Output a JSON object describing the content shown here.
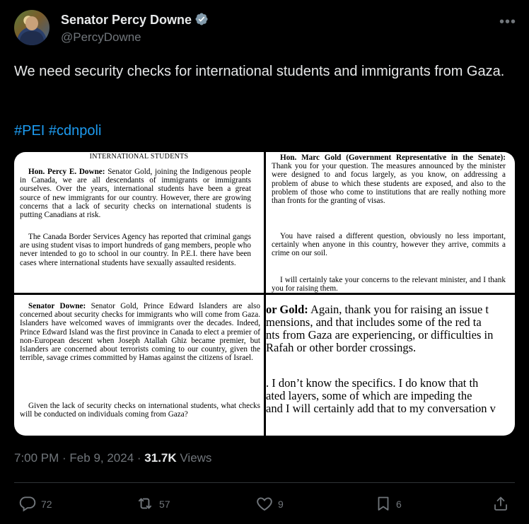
{
  "author": {
    "name": "Senator Percy Downe",
    "handle": "@PercyDowne"
  },
  "tweet": {
    "text": "We need security checks for international students and immigrants from Gaza.",
    "hashtags": "#PEI #cdnpoli"
  },
  "media": {
    "top_left": {
      "heading": "INTERNATIONAL STUDENTS",
      "speaker": "Hon. Percy E. Downe:",
      "para1": " Senator Gold, joining the Indigenous people in Canada, we are all descendants of immigrants or immigrants ourselves. Over the years, international students have been a great source of new immigrants for our country. However, there are growing concerns that a lack of security checks on international students is putting Canadians at risk.",
      "para2": "The Canada Border Services Agency has reported that criminal gangs are using student visas to import hundreds of gang members, people who never intended to go to school in our country. In P.E.I. there have been cases where international students have sexually assaulted residents."
    },
    "top_right": {
      "speaker": "Hon. Marc Gold (Government Representative in the Senate):",
      "para1": " Thank you for your question. The measures announced by the minister were designed to and focus largely, as you know, on addressing a problem of abuse to which these students are exposed, and also to the problem of those who come to institutions that are really nothing more than fronts for the granting of visas.",
      "para2": "You have raised a different question, obviously no less important, certainly when anyone in this country, however they arrive, commits a crime on our soil.",
      "para3": "I will certainly take your concerns to the relevant minister, and I thank you for raising them."
    },
    "bottom_left": {
      "speaker": "Senator Downe:",
      "para1": " Senator Gold, Prince Edward Islanders are also concerned about security checks for immigrants who will come from Gaza. Islanders have welcomed waves of immigrants over the decades. Indeed, Prince Edward Island was the first province in Canada to elect a premier of non-European descent when Joseph Atallah Ghiz became premier, but Islanders are concerned about terrorists coming to our country, given the terrible, savage crimes committed by Hamas against the citizens of Israel.",
      "para2": "Given the lack of security checks on international students, what checks will be conducted on individuals coming from Gaza?"
    },
    "bottom_right": {
      "speaker": "or Gold:",
      "line1": " Again, thank you for raising an issue t",
      "line2": "mensions, and that includes some of the red ta",
      "line3": "nts from Gaza are experiencing, or difficulties in",
      "line4": "Rafah or other border crossings.",
      "line5": ". I don’t know the specifics. I do know that th",
      "line6": "ated layers, some of which are impeding the",
      "line7": "and I will certainly add that to my conversation v"
    }
  },
  "meta": {
    "time": "7:00 PM",
    "sep1": " · ",
    "date": "Feb 9, 2024",
    "sep2": " · ",
    "views_count": "31.7K",
    "views_label": " Views"
  },
  "actions": {
    "replies": "72",
    "reposts": "57",
    "likes": "9",
    "bookmarks": "6"
  },
  "colors": {
    "background": "#000000",
    "text": "#e7e9ea",
    "secondary": "#71767b",
    "link": "#1d9bf0",
    "verified": "#829aab"
  }
}
